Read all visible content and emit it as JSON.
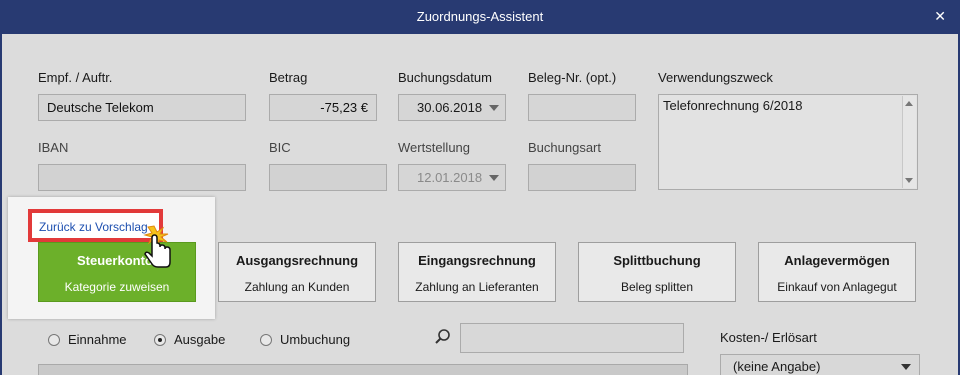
{
  "window": {
    "title": "Zuordnungs-Assistent",
    "close_glyph": "✕"
  },
  "form": {
    "payee_label": "Empf. / Auftr.",
    "payee_value": "Deutsche Telekom",
    "amount_label": "Betrag",
    "amount_value": "-75,23 €",
    "booking_date_label": "Buchungsdatum",
    "booking_date_value": "30.06.2018",
    "receipt_label": "Beleg-Nr. (opt.)",
    "receipt_value": "",
    "purpose_label": "Verwendungszweck",
    "purpose_value": "Telefonrechnung 6/2018",
    "iban_label": "IBAN",
    "iban_value": "",
    "bic_label": "BIC",
    "bic_value": "",
    "value_date_label": "Wertstellung",
    "value_date_value": "12.01.2018",
    "booking_type_label": "Buchungsart",
    "booking_type_value": ""
  },
  "back_link": "Zurück zu Vorschlag",
  "tiles": [
    {
      "title": "Steuerkonto",
      "subtitle": "Kategorie zuweisen",
      "color": "#6cb02a"
    },
    {
      "title": "Ausgangsrechnung",
      "subtitle": "Zahlung an Kunden"
    },
    {
      "title": "Eingangsrechnung",
      "subtitle": "Zahlung an Lieferanten"
    },
    {
      "title": "Splittbuchung",
      "subtitle": "Beleg splitten"
    },
    {
      "title": "Anlagevermögen",
      "subtitle": "Einkauf von Anlagegut"
    }
  ],
  "radios": [
    {
      "label": "Einnahme",
      "selected": false
    },
    {
      "label": "Ausgabe",
      "selected": true
    },
    {
      "label": "Umbuchung",
      "selected": false
    }
  ],
  "kosten": {
    "label": "Kosten-/ Erlösart",
    "value": "(keine Angabe)"
  },
  "colors": {
    "titlebar": "#283a72",
    "accent_green": "#6cb02a",
    "link": "#1e50b0",
    "highlight_border": "#e23a3a"
  },
  "icons": {
    "search": "magnifier-icon",
    "cursor": "hand-pointer-icon",
    "close": "close-icon"
  }
}
